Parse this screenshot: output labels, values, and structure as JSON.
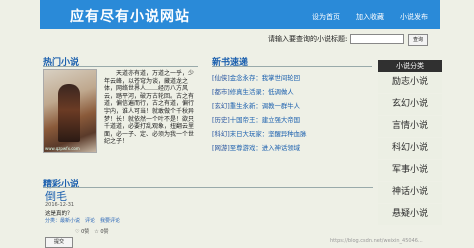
{
  "header": {
    "site_title": "应有尽有小说网站",
    "nav": [
      "设为首页",
      "加入收藏",
      "小说发布"
    ]
  },
  "search": {
    "label": "请输入要查询的小说标题:",
    "placeholder": "",
    "button": "查询"
  },
  "hot": {
    "title": "热门小说",
    "image_watermark": "www.qzpwfx.com",
    "text": "天道亦有道，万道之一乎，少年云峰，以苍穹为谈，藏道龙之体，网络世界人……经历八方风云，踏平河，破万古轮回。古之有道，偏信遍而行，古之有道，偏行宇内，谁人可当！就敢做个千秋异梦！长！就依然一个叶不是！欲只千道道，必要打乱观象，扭翻云里面，必一子、定、必须为我一个世纪之子！"
  },
  "new_books": {
    "title": "新书速递",
    "items": [
      {
        "category": "[仙侠]",
        "title": "金念永存：我掌世间轮回"
      },
      {
        "category": "[都市]",
        "title": "修真生活录：低调做人"
      },
      {
        "category": "[玄幻]",
        "title": "重生永新：调教一群牛人"
      },
      {
        "category": "[历史]",
        "title": "十国帝王：建立强大帝国"
      },
      {
        "category": "[科幻]",
        "title": "末日大玩家：坚醒异种血脉"
      },
      {
        "category": "[网游]",
        "title": "至尊游戏：进入神话领域"
      }
    ]
  },
  "sidebar": {
    "header": "小说分类",
    "items": [
      "励志小说",
      "玄幻小说",
      "言情小说",
      "科幻小说",
      "军事小说",
      "神话小说",
      "悬疑小说"
    ]
  },
  "featured": {
    "title": "精彩小说",
    "name": "倒毛",
    "date": "2016-12-31",
    "desc": "这是真的？",
    "meta": "分类：最新小说　评论　我要评论",
    "likes": "♡ 0赞　☆ 0赞",
    "button": "提交"
  },
  "watermark": "https://blog.csdn.net/weixin_45046..."
}
